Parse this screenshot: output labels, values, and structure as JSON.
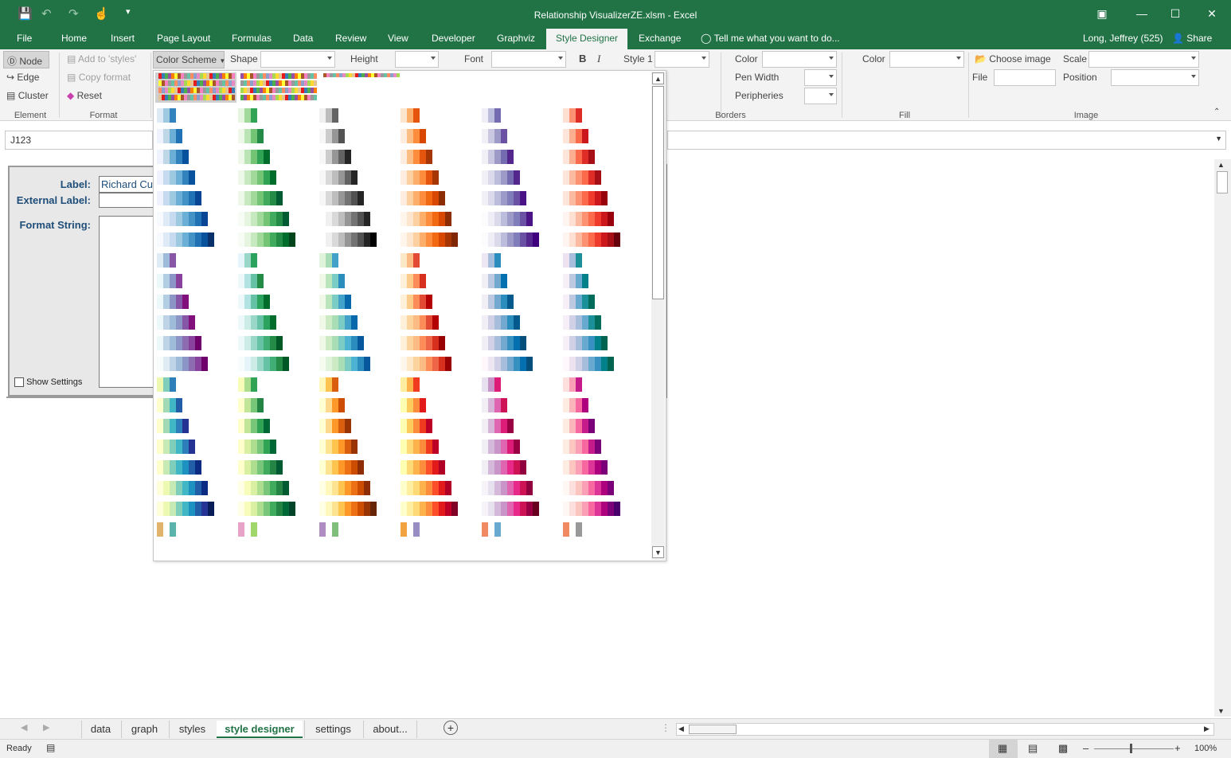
{
  "window": {
    "title": "Relationship VisualizerZE.xlsm - Excel"
  },
  "tabs": [
    "File",
    "Home",
    "Insert",
    "Page Layout",
    "Formulas",
    "Data",
    "Review",
    "View",
    "Developer",
    "Graphviz",
    "Style Designer",
    "Exchange"
  ],
  "active_tab": "Style Designer",
  "tell_me": "Tell me what you want to do...",
  "user": "Long, Jeffrey (525)",
  "share": "Share",
  "ribbon": {
    "element": {
      "node": "Node",
      "edge": "Edge",
      "cluster": "Cluster",
      "group": "Element"
    },
    "format": {
      "add": "Add to 'styles'",
      "copy": "Copy format",
      "reset": "Reset",
      "group": "Format"
    },
    "color_scheme": "Color Scheme",
    "shape": "Shape",
    "height": "Height",
    "font": "Font",
    "bold": "B",
    "italic": "I",
    "style1": "Style 1",
    "borders": {
      "color": "Color",
      "pen_width": "Pen Width",
      "peripheries": "Peripheries",
      "group": "Borders"
    },
    "fill": {
      "color": "Color",
      "group": "Fill"
    },
    "image": {
      "choose": "Choose image",
      "file": "File",
      "scale": "Scale",
      "position": "Position",
      "group": "Image"
    }
  },
  "namebox": "J123",
  "form": {
    "label": "Label:",
    "label_value": "Richard Cu",
    "external_label": "External Label:",
    "format_string": "Format String:",
    "show_settings": "Show Settings"
  },
  "sheet_tabs": [
    "data",
    "graph",
    "styles",
    "style designer",
    "settings",
    "about..."
  ],
  "active_sheet": "style designer",
  "status": {
    "ready": "Ready",
    "zoom": "100%"
  },
  "palettes": {
    "rows": [
      [
        [
          "#deebf7",
          "#9ecae1",
          "#3182bd"
        ],
        [
          "#e5f5e0",
          "#a1d99b",
          "#31a354"
        ],
        [
          "#f0f0f0",
          "#bdbdbd",
          "#636363"
        ],
        [
          "#fee6ce",
          "#fdae6b",
          "#e6550d"
        ],
        [
          "#efedf5",
          "#bcbddc",
          "#756bb1"
        ],
        [
          "#fee0d2",
          "#fc9272",
          "#de2d26"
        ]
      ],
      [
        [
          "#eff3ff",
          "#bdd7e7",
          "#6baed6",
          "#2171b5"
        ],
        [
          "#edf8e9",
          "#bae4b3",
          "#74c476",
          "#238b45"
        ],
        [
          "#f7f7f7",
          "#cccccc",
          "#969696",
          "#525252"
        ],
        [
          "#feedde",
          "#fdbe85",
          "#fd8d3c",
          "#d94701"
        ],
        [
          "#f2f0f7",
          "#cbc9e2",
          "#9e9ac8",
          "#6a51a3"
        ],
        [
          "#fee5d9",
          "#fcae91",
          "#fb6a4a",
          "#cb181d"
        ]
      ],
      [
        [
          "#eff3ff",
          "#bdd7e7",
          "#6baed6",
          "#3182bd",
          "#08519c"
        ],
        [
          "#edf8e9",
          "#bae4b3",
          "#74c476",
          "#31a354",
          "#006d2c"
        ],
        [
          "#f7f7f7",
          "#cccccc",
          "#969696",
          "#636363",
          "#252525"
        ],
        [
          "#feedde",
          "#fdbe85",
          "#fd8d3c",
          "#e6550d",
          "#a63603"
        ],
        [
          "#f2f0f7",
          "#cbc9e2",
          "#9e9ac8",
          "#756bb1",
          "#54278f"
        ],
        [
          "#fee5d9",
          "#fcae91",
          "#fb6a4a",
          "#de2d26",
          "#a50f15"
        ]
      ],
      [
        [
          "#eff3ff",
          "#c6dbef",
          "#9ecae1",
          "#6baed6",
          "#3182bd",
          "#08519c"
        ],
        [
          "#edf8e9",
          "#c7e9c0",
          "#a1d99b",
          "#74c476",
          "#31a354",
          "#006d2c"
        ],
        [
          "#f7f7f7",
          "#d9d9d9",
          "#bdbdbd",
          "#969696",
          "#636363",
          "#252525"
        ],
        [
          "#feedde",
          "#fdd0a2",
          "#fdae6b",
          "#fd8d3c",
          "#e6550d",
          "#a63603"
        ],
        [
          "#f2f0f7",
          "#dadaeb",
          "#bcbddc",
          "#9e9ac8",
          "#756bb1",
          "#54278f"
        ],
        [
          "#fee5d9",
          "#fcbba1",
          "#fc9272",
          "#fb6a4a",
          "#de2d26",
          "#a50f15"
        ]
      ],
      [
        [
          "#eff3ff",
          "#c6dbef",
          "#9ecae1",
          "#6baed6",
          "#4292c6",
          "#2171b5",
          "#084594"
        ],
        [
          "#edf8e9",
          "#c7e9c0",
          "#a1d99b",
          "#74c476",
          "#41ab5d",
          "#238b45",
          "#005a32"
        ],
        [
          "#f7f7f7",
          "#d9d9d9",
          "#bdbdbd",
          "#969696",
          "#737373",
          "#525252",
          "#252525"
        ],
        [
          "#feedde",
          "#fdd0a2",
          "#fdae6b",
          "#fd8d3c",
          "#f16913",
          "#d94801",
          "#8c2d04"
        ],
        [
          "#f2f0f7",
          "#dadaeb",
          "#bcbddc",
          "#9e9ac8",
          "#807dba",
          "#6a51a3",
          "#4a1486"
        ],
        [
          "#fee5d9",
          "#fcbba1",
          "#fc9272",
          "#fb6a4a",
          "#ef3b2c",
          "#cb181d",
          "#99000d"
        ]
      ],
      [
        [
          "#f7fbff",
          "#deebf7",
          "#c6dbef",
          "#9ecae1",
          "#6baed6",
          "#4292c6",
          "#2171b5",
          "#084594"
        ],
        [
          "#f7fcf5",
          "#e5f5e0",
          "#c7e9c0",
          "#a1d99b",
          "#74c476",
          "#41ab5d",
          "#238b45",
          "#005a32"
        ],
        [
          "#ffffff",
          "#f0f0f0",
          "#d9d9d9",
          "#bdbdbd",
          "#969696",
          "#737373",
          "#525252",
          "#252525"
        ],
        [
          "#fff5eb",
          "#fee6ce",
          "#fdd0a2",
          "#fdae6b",
          "#fd8d3c",
          "#f16913",
          "#d94801",
          "#8c2d04"
        ],
        [
          "#fcfbfd",
          "#efedf5",
          "#dadaeb",
          "#bcbddc",
          "#9e9ac8",
          "#807dba",
          "#6a51a3",
          "#4a1486"
        ],
        [
          "#fff5f0",
          "#fee0d2",
          "#fcbba1",
          "#fc9272",
          "#fb6a4a",
          "#ef3b2c",
          "#cb181d",
          "#99000d"
        ]
      ],
      [
        [
          "#f7fbff",
          "#deebf7",
          "#c6dbef",
          "#9ecae1",
          "#6baed6",
          "#4292c6",
          "#2171b5",
          "#08519c",
          "#08306b"
        ],
        [
          "#f7fcf5",
          "#e5f5e0",
          "#c7e9c0",
          "#a1d99b",
          "#74c476",
          "#41ab5d",
          "#238b45",
          "#006d2c",
          "#00441b"
        ],
        [
          "#ffffff",
          "#f0f0f0",
          "#d9d9d9",
          "#bdbdbd",
          "#969696",
          "#737373",
          "#525252",
          "#252525",
          "#000000"
        ],
        [
          "#fff5eb",
          "#fee6ce",
          "#fdd0a2",
          "#fdae6b",
          "#fd8d3c",
          "#f16913",
          "#d94801",
          "#a63603",
          "#7f2704"
        ],
        [
          "#fcfbfd",
          "#efedf5",
          "#dadaeb",
          "#bcbddc",
          "#9e9ac8",
          "#807dba",
          "#6a51a3",
          "#54278f",
          "#3f007d"
        ],
        [
          "#fff5f0",
          "#fee0d2",
          "#fcbba1",
          "#fc9272",
          "#fb6a4a",
          "#ef3b2c",
          "#cb181d",
          "#a50f15",
          "#67000d"
        ]
      ],
      [
        [
          "#e0ecf4",
          "#9ebcda",
          "#8856a7"
        ],
        [
          "#e5f5f9",
          "#99d8c9",
          "#2ca25f"
        ],
        [
          "#e0f3db",
          "#a8ddb5",
          "#43a2ca"
        ],
        [
          "#fee8c8",
          "#fdbb84",
          "#e34a33"
        ],
        [
          "#ece7f2",
          "#a6bddb",
          "#2b8cbe"
        ],
        [
          "#ece2f0",
          "#a6bddb",
          "#1c9099"
        ]
      ],
      [
        [
          "#edf8fb",
          "#b3cde3",
          "#8c96c6",
          "#88419d"
        ],
        [
          "#edf8fb",
          "#b2e2e2",
          "#66c2a4",
          "#238b45"
        ],
        [
          "#f0f9e8",
          "#bae4bc",
          "#7bccc4",
          "#2b8cbe"
        ],
        [
          "#fef0d9",
          "#fdcc8a",
          "#fc8d59",
          "#d7301f"
        ],
        [
          "#f1eef6",
          "#bdc9e1",
          "#74a9cf",
          "#0570b0"
        ],
        [
          "#f6eff7",
          "#bdc9e1",
          "#67a9cf",
          "#02818a"
        ]
      ],
      [
        [
          "#edf8fb",
          "#b3cde3",
          "#8c96c6",
          "#8856a7",
          "#810f7c"
        ],
        [
          "#edf8fb",
          "#b2e2e2",
          "#66c2a4",
          "#2ca25f",
          "#006d2c"
        ],
        [
          "#f0f9e8",
          "#bae4bc",
          "#7bccc4",
          "#43a2ca",
          "#0868ac"
        ],
        [
          "#fef0d9",
          "#fdcc8a",
          "#fc8d59",
          "#e34a33",
          "#b30000"
        ],
        [
          "#f1eef6",
          "#bdc9e1",
          "#74a9cf",
          "#2b8cbe",
          "#045a8d"
        ],
        [
          "#f6eff7",
          "#bdc9e1",
          "#67a9cf",
          "#1c9099",
          "#016c59"
        ]
      ],
      [
        [
          "#edf8fb",
          "#bfd3e6",
          "#9ebcda",
          "#8c96c6",
          "#8856a7",
          "#810f7c"
        ],
        [
          "#edf8fb",
          "#ccece6",
          "#99d8c9",
          "#66c2a4",
          "#2ca25f",
          "#006d2c"
        ],
        [
          "#f0f9e8",
          "#ccebc5",
          "#a8ddb5",
          "#7bccc4",
          "#43a2ca",
          "#0868ac"
        ],
        [
          "#fef0d9",
          "#fdd49e",
          "#fdbb84",
          "#fc8d59",
          "#e34a33",
          "#b30000"
        ],
        [
          "#f1eef6",
          "#d0d1e6",
          "#a6bddb",
          "#74a9cf",
          "#2b8cbe",
          "#045a8d"
        ],
        [
          "#f6eff7",
          "#d0d1e6",
          "#a6bddb",
          "#67a9cf",
          "#1c9099",
          "#016c59"
        ]
      ],
      [
        [
          "#edf8fb",
          "#bfd3e6",
          "#9ebcda",
          "#8c96c6",
          "#8c6bb1",
          "#88419d",
          "#6e016b"
        ],
        [
          "#edf8fb",
          "#ccece6",
          "#99d8c9",
          "#66c2a4",
          "#41ae76",
          "#238b45",
          "#005824"
        ],
        [
          "#f0f9e8",
          "#ccebc5",
          "#a8ddb5",
          "#7bccc4",
          "#4eb3d3",
          "#2b8cbe",
          "#08589e"
        ],
        [
          "#fef0d9",
          "#fdd49e",
          "#fdbb84",
          "#fc8d59",
          "#ef6548",
          "#d7301f",
          "#990000"
        ],
        [
          "#f1eef6",
          "#d0d1e6",
          "#a6bddb",
          "#74a9cf",
          "#3690c0",
          "#0570b0",
          "#034e7b"
        ],
        [
          "#f6eff7",
          "#d0d1e6",
          "#a6bddb",
          "#67a9cf",
          "#3690c0",
          "#02818a",
          "#016450"
        ]
      ],
      [
        [
          "#f7fcfd",
          "#e0ecf4",
          "#bfd3e6",
          "#9ebcda",
          "#8c96c6",
          "#8c6bb1",
          "#88419d",
          "#6e016b"
        ],
        [
          "#f7fcfd",
          "#e5f5f9",
          "#ccece6",
          "#99d8c9",
          "#66c2a4",
          "#41ae76",
          "#238b45",
          "#005824"
        ],
        [
          "#f7fcf0",
          "#e0f3db",
          "#ccebc5",
          "#a8ddb5",
          "#7bccc4",
          "#4eb3d3",
          "#2b8cbe",
          "#08589e"
        ],
        [
          "#fff7ec",
          "#fee8c8",
          "#fdd49e",
          "#fdbb84",
          "#fc8d59",
          "#ef6548",
          "#d7301f",
          "#990000"
        ],
        [
          "#fff7fb",
          "#ece7f2",
          "#d0d1e6",
          "#a6bddb",
          "#74a9cf",
          "#3690c0",
          "#0570b0",
          "#034e7b"
        ],
        [
          "#fff7fb",
          "#ece2f0",
          "#d0d1e6",
          "#a6bddb",
          "#67a9cf",
          "#3690c0",
          "#02818a",
          "#016450"
        ]
      ],
      [
        [
          "#edf8b1",
          "#7fcdbb",
          "#2c7fb8"
        ],
        [
          "#f7fcb9",
          "#addd8e",
          "#31a354"
        ],
        [
          "#fff7bc",
          "#fec44f",
          "#d95f0e"
        ],
        [
          "#ffeda0",
          "#feb24c",
          "#f03b20"
        ],
        [
          "#e7e1ef",
          "#c994c7",
          "#dd1c77"
        ],
        [
          "#fde0dd",
          "#fa9fb5",
          "#c51b8a"
        ]
      ],
      [
        [
          "#ffffcc",
          "#a1dab4",
          "#41b6c4",
          "#225ea8"
        ],
        [
          "#ffffcc",
          "#c2e699",
          "#78c679",
          "#238443"
        ],
        [
          "#ffffd4",
          "#fed98e",
          "#fe9929",
          "#cc4c02"
        ],
        [
          "#ffffb2",
          "#fecc5c",
          "#fd8d3c",
          "#e31a1c"
        ],
        [
          "#f1eef6",
          "#d7b5d8",
          "#df65b0",
          "#ce1256"
        ],
        [
          "#feebe2",
          "#fbb4b9",
          "#f768a1",
          "#ae017e"
        ]
      ],
      [
        [
          "#ffffcc",
          "#a1dab4",
          "#41b6c4",
          "#2c7fb8",
          "#253494"
        ],
        [
          "#ffffcc",
          "#c2e699",
          "#78c679",
          "#31a354",
          "#006837"
        ],
        [
          "#ffffd4",
          "#fed98e",
          "#fe9929",
          "#d95f0e",
          "#993404"
        ],
        [
          "#ffffb2",
          "#fecc5c",
          "#fd8d3c",
          "#f03b20",
          "#bd0026"
        ],
        [
          "#f1eef6",
          "#d7b5d8",
          "#df65b0",
          "#dd1c77",
          "#980043"
        ],
        [
          "#feebe2",
          "#fbb4b9",
          "#f768a1",
          "#c51b8a",
          "#7a0177"
        ]
      ],
      [
        [
          "#ffffcc",
          "#c7e9b4",
          "#7fcdbb",
          "#41b6c4",
          "#2c7fb8",
          "#253494"
        ],
        [
          "#ffffcc",
          "#d9f0a3",
          "#addd8e",
          "#78c679",
          "#31a354",
          "#006837"
        ],
        [
          "#ffffd4",
          "#fee391",
          "#fec44f",
          "#fe9929",
          "#d95f0e",
          "#993404"
        ],
        [
          "#ffffb2",
          "#fed976",
          "#feb24c",
          "#fd8d3c",
          "#f03b20",
          "#bd0026"
        ],
        [
          "#f1eef6",
          "#d4b9da",
          "#c994c7",
          "#df65b0",
          "#dd1c77",
          "#980043"
        ],
        [
          "#feebe2",
          "#fcc5c0",
          "#fa9fb5",
          "#f768a1",
          "#c51b8a",
          "#7a0177"
        ]
      ],
      [
        [
          "#ffffcc",
          "#c7e9b4",
          "#7fcdbb",
          "#41b6c4",
          "#1d91c0",
          "#225ea8",
          "#0c2c84"
        ],
        [
          "#ffffcc",
          "#d9f0a3",
          "#addd8e",
          "#78c679",
          "#41ab5d",
          "#238443",
          "#005a32"
        ],
        [
          "#ffffd4",
          "#fee391",
          "#fec44f",
          "#fe9929",
          "#ec7014",
          "#cc4c02",
          "#8c2d04"
        ],
        [
          "#ffffb2",
          "#fed976",
          "#feb24c",
          "#fd8d3c",
          "#fc4e2a",
          "#e31a1c",
          "#b10026"
        ],
        [
          "#f1eef6",
          "#d4b9da",
          "#c994c7",
          "#df65b0",
          "#e7298a",
          "#ce1256",
          "#91003f"
        ],
        [
          "#feebe2",
          "#fcc5c0",
          "#fa9fb5",
          "#f768a1",
          "#dd3497",
          "#ae017e",
          "#7a0177"
        ]
      ],
      [
        [
          "#ffffd9",
          "#edf8b1",
          "#c7e9b4",
          "#7fcdbb",
          "#41b6c4",
          "#1d91c0",
          "#225ea8",
          "#0c2c84"
        ],
        [
          "#ffffe5",
          "#f7fcb9",
          "#d9f0a3",
          "#addd8e",
          "#78c679",
          "#41ab5d",
          "#238443",
          "#005a32"
        ],
        [
          "#ffffe5",
          "#fff7bc",
          "#fee391",
          "#fec44f",
          "#fe9929",
          "#ec7014",
          "#cc4c02",
          "#8c2d04"
        ],
        [
          "#ffffcc",
          "#ffeda0",
          "#fed976",
          "#feb24c",
          "#fd8d3c",
          "#fc4e2a",
          "#e31a1c",
          "#b10026"
        ],
        [
          "#f7f4f9",
          "#e7e1ef",
          "#d4b9da",
          "#c994c7",
          "#df65b0",
          "#e7298a",
          "#ce1256",
          "#91003f"
        ],
        [
          "#fff7f3",
          "#fde0dd",
          "#fcc5c0",
          "#fa9fb5",
          "#f768a1",
          "#dd3497",
          "#ae017e",
          "#7a0177"
        ]
      ],
      [
        [
          "#ffffd9",
          "#edf8b1",
          "#c7e9b4",
          "#7fcdbb",
          "#41b6c4",
          "#1d91c0",
          "#225ea8",
          "#253494",
          "#081d58"
        ],
        [
          "#ffffe5",
          "#f7fcb9",
          "#d9f0a3",
          "#addd8e",
          "#78c679",
          "#41ab5d",
          "#238443",
          "#006837",
          "#004529"
        ],
        [
          "#ffffe5",
          "#fff7bc",
          "#fee391",
          "#fec44f",
          "#fe9929",
          "#ec7014",
          "#cc4c02",
          "#993404",
          "#662506"
        ],
        [
          "#ffffcc",
          "#ffeda0",
          "#fed976",
          "#feb24c",
          "#fd8d3c",
          "#fc4e2a",
          "#e31a1c",
          "#bd0026",
          "#800026"
        ],
        [
          "#f7f4f9",
          "#e7e1ef",
          "#d4b9da",
          "#c994c7",
          "#df65b0",
          "#e7298a",
          "#ce1256",
          "#980043",
          "#67001f"
        ],
        [
          "#fff7f3",
          "#fde0dd",
          "#fcc5c0",
          "#fa9fb5",
          "#f768a1",
          "#dd3497",
          "#ae017e",
          "#7a0177",
          "#49006a"
        ]
      ],
      [
        [
          "#e2b36a",
          "#ffffff",
          "#5ab4ac"
        ],
        [
          "#e9a3c9",
          "#ffffff",
          "#a1d76a"
        ],
        [
          "#af8dc3",
          "#ffffff",
          "#7fbf7b"
        ],
        [
          "#f1a340",
          "#ffffff",
          "#998ec3"
        ],
        [
          "#ef8a62",
          "#ffffff",
          "#67a9cf"
        ],
        [
          "#ef8a62",
          "#ffffff",
          "#999999"
        ]
      ]
    ]
  }
}
